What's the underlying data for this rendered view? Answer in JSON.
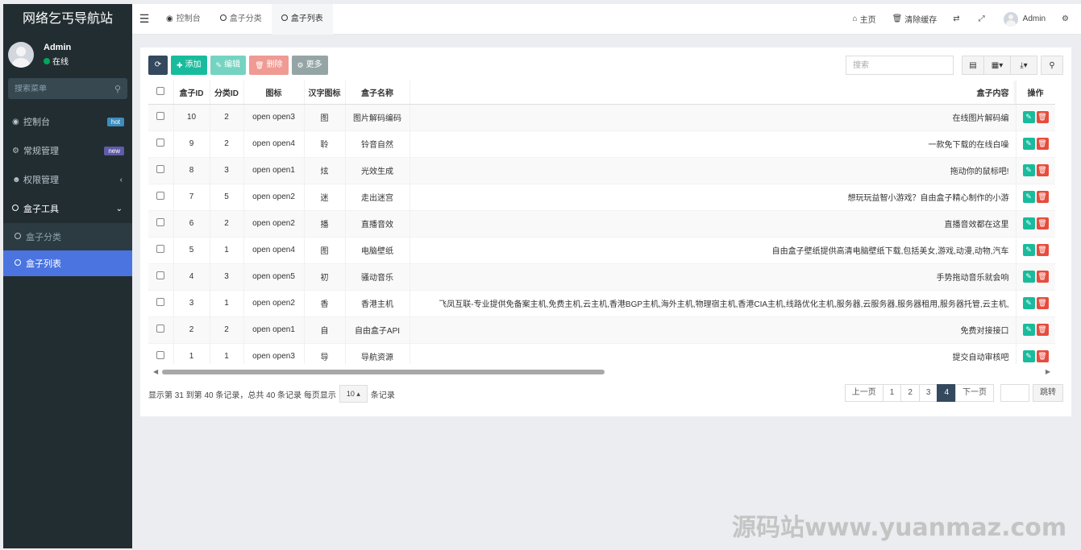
{
  "sidebar": {
    "title": "网络乞丐导航站",
    "user": {
      "name": "Admin",
      "status": "在线"
    },
    "search_placeholder": "搜索菜单",
    "items": [
      {
        "label": "控制台",
        "badge": "hot"
      },
      {
        "label": "常规管理",
        "badge": "new"
      },
      {
        "label": "权限管理"
      },
      {
        "label": "盒子工具"
      }
    ],
    "sub_items": [
      {
        "label": "盒子分类"
      },
      {
        "label": "盒子列表"
      }
    ]
  },
  "topbar": {
    "tabs": [
      {
        "label": "控制台"
      },
      {
        "label": "盒子分类"
      },
      {
        "label": "盒子列表"
      }
    ],
    "home": "主页",
    "clear_cache": "清除缓存",
    "user": "Admin"
  },
  "toolbar": {
    "add": "添加",
    "edit": "编辑",
    "delete": "删除",
    "more": "更多",
    "search_placeholder": "搜索"
  },
  "table": {
    "headers": {
      "id": "盒子ID",
      "cat_id": "分类ID",
      "icon": "图标",
      "hanzi_icon": "汉字图标",
      "name": "盒子名称",
      "content": "盒子内容",
      "ops": "操作"
    },
    "rows": [
      {
        "id": "10",
        "cat_id": "2",
        "icon": "open open3",
        "hanzi": "图",
        "name": "图片解码编码",
        "content": "在线图片解码编"
      },
      {
        "id": "9",
        "cat_id": "2",
        "icon": "open open4",
        "hanzi": "聆",
        "name": "铃音自然",
        "content": "一款免下载的在线白噪"
      },
      {
        "id": "8",
        "cat_id": "3",
        "icon": "open open1",
        "hanzi": "炫",
        "name": "光效生成",
        "content": "拖动你的鼠标吧!"
      },
      {
        "id": "7",
        "cat_id": "5",
        "icon": "open open2",
        "hanzi": "迷",
        "name": "走出迷宫",
        "content": "想玩玩益智小游戏？自由盒子精心制作的小游"
      },
      {
        "id": "6",
        "cat_id": "2",
        "icon": "open open2",
        "hanzi": "播",
        "name": "直播音效",
        "content": "直播音效都在这里"
      },
      {
        "id": "5",
        "cat_id": "1",
        "icon": "open open4",
        "hanzi": "图",
        "name": "电脑壁纸",
        "content": "自由盒子壁纸提供高清电脑壁纸下载,包括美女,游戏,动漫,动物,汽车"
      },
      {
        "id": "4",
        "cat_id": "3",
        "icon": "open open5",
        "hanzi": "初",
        "name": "骚动音乐",
        "content": "手势拖动音乐就会响"
      },
      {
        "id": "3",
        "cat_id": "1",
        "icon": "open open2",
        "hanzi": "香",
        "name": "香港主机",
        "content": "飞凤互联-专业提供免备案主机,免费主机,云主机,香港BGP主机,海外主机,物理宿主机,香港CIA主机,线路优化主机,服务器,云服务器,服务器租用,服务器托管,云主机,"
      },
      {
        "id": "2",
        "cat_id": "2",
        "icon": "open open1",
        "hanzi": "自",
        "name": "自由盒子API",
        "content": "免费对接接口"
      },
      {
        "id": "1",
        "cat_id": "1",
        "icon": "open open3",
        "hanzi": "导",
        "name": "导航资源",
        "content": "提交自动审核吧"
      }
    ]
  },
  "footer": {
    "info_prefix": "显示第 31 到第 40 条记录，总共 40 条记录 每页显示",
    "page_size": "10 ▴",
    "info_suffix": "条记录",
    "prev": "上一页",
    "pages": [
      "1",
      "2",
      "3",
      "4"
    ],
    "next": "下一页",
    "go": "跳转"
  },
  "watermark": "源码站www.yuanmaz.com"
}
